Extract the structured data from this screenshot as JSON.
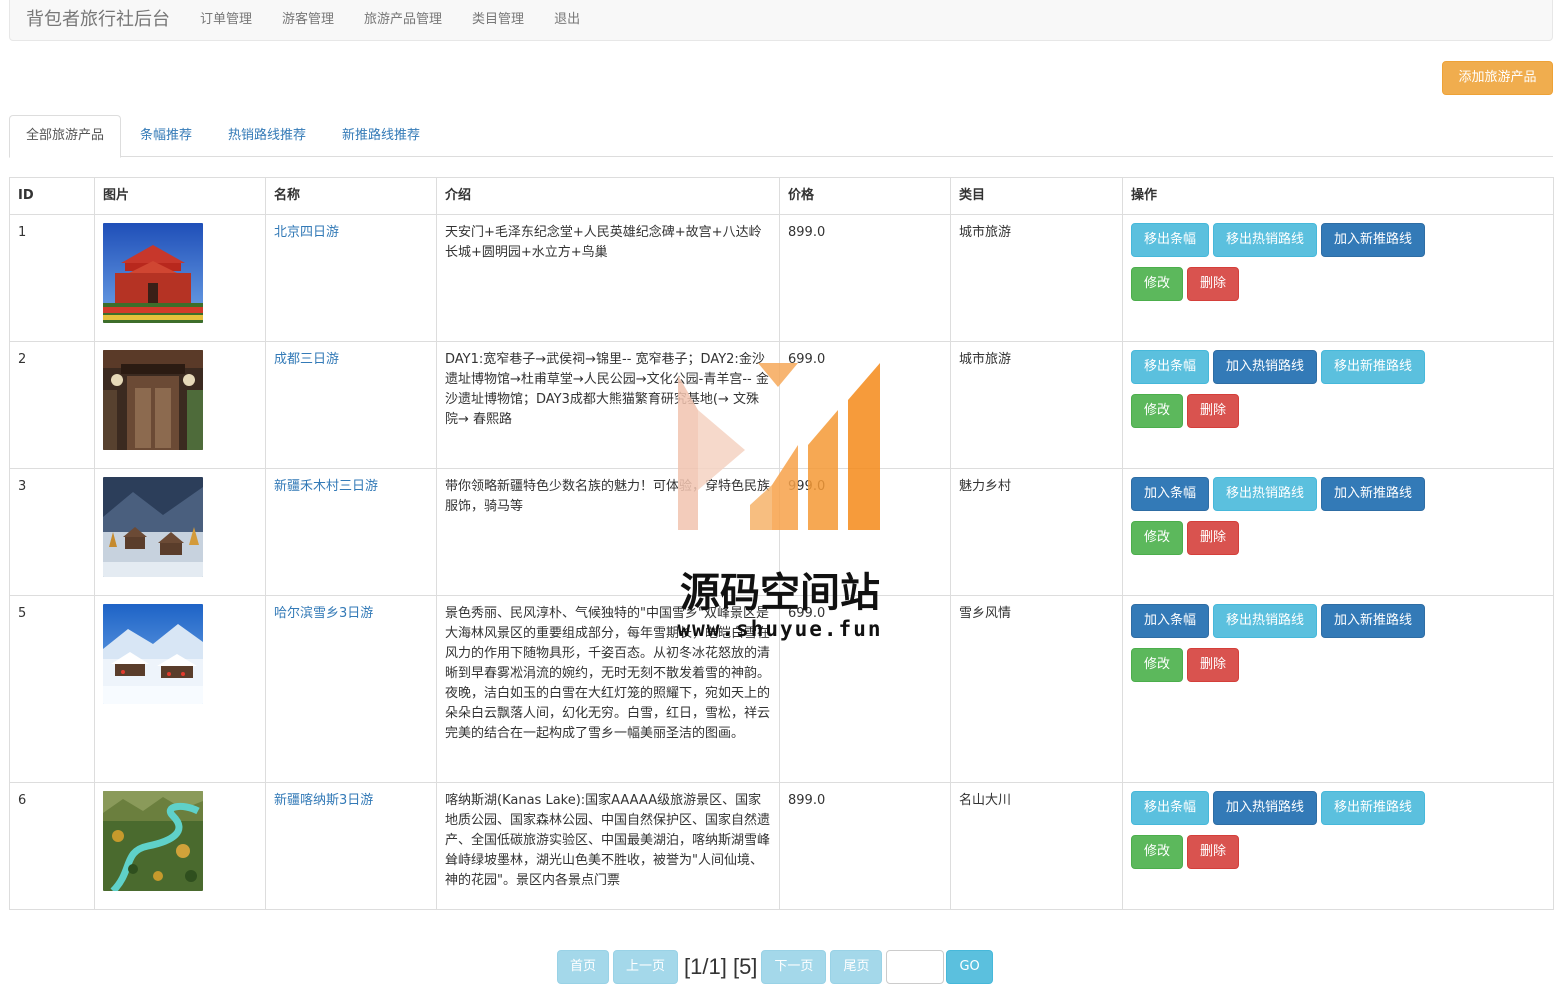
{
  "navbar": {
    "brand": "背包者旅行社后台",
    "links": [
      "订单管理",
      "游客管理",
      "旅游产品管理",
      "类目管理",
      "退出"
    ]
  },
  "add_button": "添加旅游产品",
  "tabs": [
    "全部旅游产品",
    "条幅推荐",
    "热销路线推荐",
    "新推路线推荐"
  ],
  "table": {
    "headers": [
      "ID",
      "图片",
      "名称",
      "介绍",
      "价格",
      "类目",
      "操作"
    ],
    "rows": [
      {
        "id": "1",
        "image": "beijing-tiananmen-photo",
        "name": "北京四日游",
        "desc": "天安门+毛泽东纪念堂+人民英雄纪念碑+故宫+八达岭长城+圆明园+水立方+鸟巢",
        "price": "899.0",
        "category": "城市旅游",
        "banner_btn": "移出条幅",
        "hot_btn": "移出热销路线",
        "new_btn": "加入新推路线",
        "edit_btn": "修改",
        "delete_btn": "删除"
      },
      {
        "id": "2",
        "image": "chengdu-alley-photo",
        "name": "成都三日游",
        "desc": "DAY1:宽窄巷子→武侯祠→锦里-- 宽窄巷子；DAY2:金沙遗址博物馆→杜甫草堂→人民公园→文化公园-青羊宫-- 金沙遗址博物馆；DAY3成都大熊猫繁育研究基地(→ 文殊院→ 春熙路",
        "price": "699.0",
        "category": "城市旅游",
        "banner_btn": "移出条幅",
        "hot_btn": "加入热销路线",
        "new_btn": "移出新推路线",
        "edit_btn": "修改",
        "delete_btn": "删除"
      },
      {
        "id": "3",
        "image": "hemu-village-photo",
        "name": "新疆禾木村三日游",
        "desc": "带你领略新疆特色少数名族的魅力！可体验，穿特色民族服饰，骑马等",
        "price": "999.0",
        "category": "魅力乡村",
        "banner_btn": "加入条幅",
        "hot_btn": "移出热销路线",
        "new_btn": "加入新推路线",
        "edit_btn": "修改",
        "delete_btn": "删除"
      },
      {
        "id": "5",
        "image": "harbin-snow-village-photo",
        "name": "哈尔滨雪乡3日游",
        "desc": "景色秀丽、民风淳朴、气候独特的\"中国雪乡\"双峰景区是大海林风景区的重要组成部分，每年雪期长，皑皑白雪在风力的作用下随物具形，千姿百态。从初冬冰花怒放的清晰到早春雾凇涓流的婉约，无时无刻不散发着雪的神韵。夜晚，洁白如玉的白雪在大红灯笼的照耀下，宛如天上的朵朵白云飘落人间，幻化无穷。白雪，红日，雪松，祥云完美的结合在一起构成了雪乡一幅美丽圣洁的图画。",
        "price": "699.0",
        "category": "雪乡风情",
        "banner_btn": "加入条幅",
        "hot_btn": "移出热销路线",
        "new_btn": "加入新推路线",
        "edit_btn": "修改",
        "delete_btn": "删除"
      },
      {
        "id": "6",
        "image": "kanas-river-photo",
        "name": "新疆喀纳斯3日游",
        "desc": "喀纳斯湖(Kanas Lake):国家AAAAA级旅游景区、国家地质公园、国家森林公园、中国自然保护区、国家自然遗产、全国低碳旅游实验区、中国最美湖泊，喀纳斯湖雪峰耸峙绿坡墨林，湖光山色美不胜收，被誉为\"人间仙境、神的花园\"。景区内各景点门票",
        "price": "899.0",
        "category": "名山大川",
        "banner_btn": "移出条幅",
        "hot_btn": "加入热销路线",
        "new_btn": "移出新推路线",
        "edit_btn": "修改",
        "delete_btn": "删除"
      }
    ]
  },
  "watermark": {
    "title": "源码空间站",
    "url": "www.shuyue.fun"
  },
  "pagination": {
    "first": "首页",
    "prev": "上一页",
    "info": "[1/1] [5]",
    "next": "下一页",
    "last": "尾页",
    "go_value": "",
    "go": "GO"
  }
}
